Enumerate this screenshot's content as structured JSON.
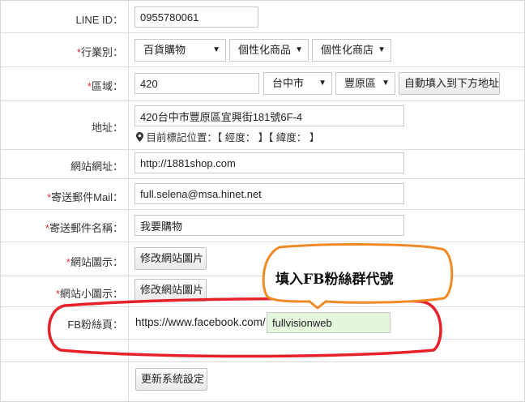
{
  "form": {
    "line_id": {
      "label": "LINE ID：",
      "value": "0955780061"
    },
    "industry": {
      "label": "行業別：",
      "required": "*",
      "options": [
        "百貨購物",
        "個性化商品",
        "個性化商店"
      ]
    },
    "region": {
      "label": "區域：",
      "required": "*",
      "postal_code": "420",
      "city": "台中市",
      "district": "豐原區",
      "auto_fill_button": "自動填入到下方地址"
    },
    "address": {
      "label": "地址：",
      "value": "420台中市豐原區宜興街181號6F-4",
      "location_hint": "目前標記位置：【 經度： 】【 緯度： 】"
    },
    "website": {
      "label": "網站網址：",
      "value": "http://1881shop.com"
    },
    "sender_email": {
      "label": "寄送郵件Mail：",
      "required": "*",
      "value": "full.selena@msa.hinet.net"
    },
    "sender_name": {
      "label": "寄送郵件名稱：",
      "required": "*",
      "value": "我要購物"
    },
    "site_icon": {
      "label": "網站圖示：",
      "required": "*",
      "button": "修改網站圖片"
    },
    "site_small_icon": {
      "label": "網站小圖示：",
      "required": "*",
      "button": "修改網站圖片"
    },
    "fb_page": {
      "label": "FB粉絲頁：",
      "prefix": "https://www.facebook.com/",
      "value": "fullvisionweb"
    },
    "submit_button": "更新系統設定"
  },
  "annotation": {
    "callout_text": "填入FB粉絲群代號",
    "callout_color": "#f08a24",
    "highlight_color": "#e8202a"
  },
  "colors": {
    "required": "#e0302a",
    "border": "#dcdcdc",
    "fb_input_bg": "#e4f7dc"
  }
}
